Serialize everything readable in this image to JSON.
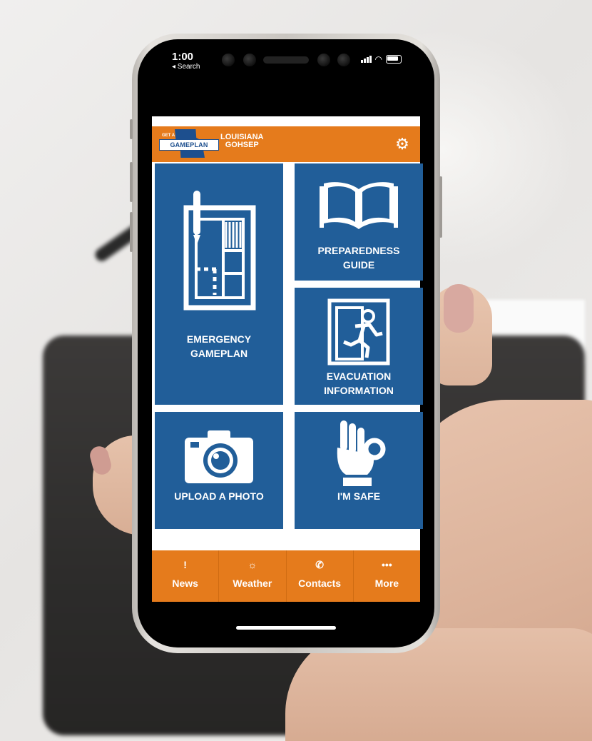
{
  "status_bar": {
    "time": "1:00",
    "back_label": "◂ Search"
  },
  "header": {
    "logo_text": "GAMEPLAN",
    "logo_small": "GET A",
    "title_line1": "LOUISIANA",
    "title_line2": "GOHSEP",
    "settings_icon": "gear-icon"
  },
  "tiles": [
    {
      "id": "emergency",
      "line1": "EMERGENCY",
      "line2": "GAMEPLAN",
      "icon": "floorplan-icon"
    },
    {
      "id": "preparedness",
      "line1": "PREPAREDNESS",
      "line2": "GUIDE",
      "icon": "open-book-icon"
    },
    {
      "id": "evacuation",
      "line1": "EVACUATION",
      "line2": "INFORMATION",
      "icon": "exit-sign-icon"
    },
    {
      "id": "upload",
      "line1": "UPLOAD A PHOTO",
      "line2": "",
      "icon": "camera-icon"
    },
    {
      "id": "safe",
      "line1": "I'M SAFE",
      "line2": "",
      "icon": "ok-hand-icon"
    }
  ],
  "bottom_nav": [
    {
      "label": "News",
      "icon": "!"
    },
    {
      "label": "Weather",
      "icon": "☼"
    },
    {
      "label": "Contacts",
      "icon": "✆"
    },
    {
      "label": "More",
      "icon": "•••"
    }
  ],
  "colors": {
    "brand_orange": "#e57b1c",
    "tile_blue": "#215e99"
  }
}
